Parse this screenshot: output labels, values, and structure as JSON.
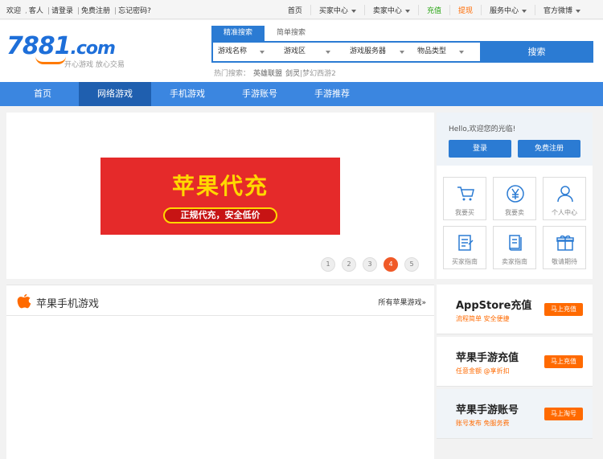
{
  "topbar": {
    "welcome": "欢迎",
    "guest": "客人",
    "login": "请登录",
    "register": "免费注册",
    "forgot": "忘记密码?",
    "nav": [
      {
        "label": "首页",
        "arrow": false,
        "color": ""
      },
      {
        "label": "买家中心",
        "arrow": true,
        "color": ""
      },
      {
        "label": "卖家中心",
        "arrow": true,
        "color": ""
      },
      {
        "label": "充值",
        "arrow": false,
        "color": "green"
      },
      {
        "label": "提现",
        "arrow": false,
        "color": "orange"
      },
      {
        "label": "服务中心",
        "arrow": true,
        "color": ""
      },
      {
        "label": "官方微博",
        "arrow": true,
        "color": ""
      }
    ]
  },
  "logo": {
    "text": "7881",
    "domain": ".com",
    "slogan": "开心游戏 放心交易"
  },
  "search": {
    "tabs": [
      "精准搜索",
      "简单搜索"
    ],
    "selects": [
      "游戏名称",
      "游戏区",
      "游戏服务器",
      "物品类型"
    ],
    "button": "搜索",
    "hot_label": "热门搜索：",
    "hot": [
      "英雄联盟",
      "剑灵",
      "梦幻西游2"
    ]
  },
  "mainnav": [
    "首页",
    "网络游戏",
    "手机游戏",
    "手游账号",
    "手游推荐"
  ],
  "banner": {
    "title": "苹果代充",
    "subtitle": "正规代充，安全低价",
    "pages": [
      "1",
      "2",
      "3",
      "4",
      "5"
    ],
    "active_page": 3
  },
  "user": {
    "hello": "Hello,欢迎您的光临!",
    "login": "登录",
    "register": "免费注册",
    "grid": [
      {
        "label": "我要买",
        "icon": "cart-icon"
      },
      {
        "label": "我要卖",
        "icon": "yen-icon"
      },
      {
        "label": "个人中心",
        "icon": "user-icon"
      },
      {
        "label": "买家指南",
        "icon": "buyer-guide-icon"
      },
      {
        "label": "卖家指南",
        "icon": "seller-guide-icon"
      },
      {
        "label": "敬请期待",
        "icon": "gift-icon"
      }
    ]
  },
  "content": {
    "title": "苹果手机游戏",
    "more": "所有苹果游戏»"
  },
  "side": [
    {
      "title": "AppStore充值",
      "sub": "流程简单 安全便捷",
      "btn": "马上充值"
    },
    {
      "title": "苹果手游充值",
      "sub": "任意金额 @享折扣",
      "btn": "马上充值"
    },
    {
      "title": "苹果手游账号",
      "sub": "账号发布 免服务费",
      "btn": "马上淘号"
    }
  ],
  "colors": {
    "primary": "#2b7bd3",
    "nav": "#3b86e0",
    "accent": "#ff6a00",
    "banner_red": "#e52a2a"
  }
}
